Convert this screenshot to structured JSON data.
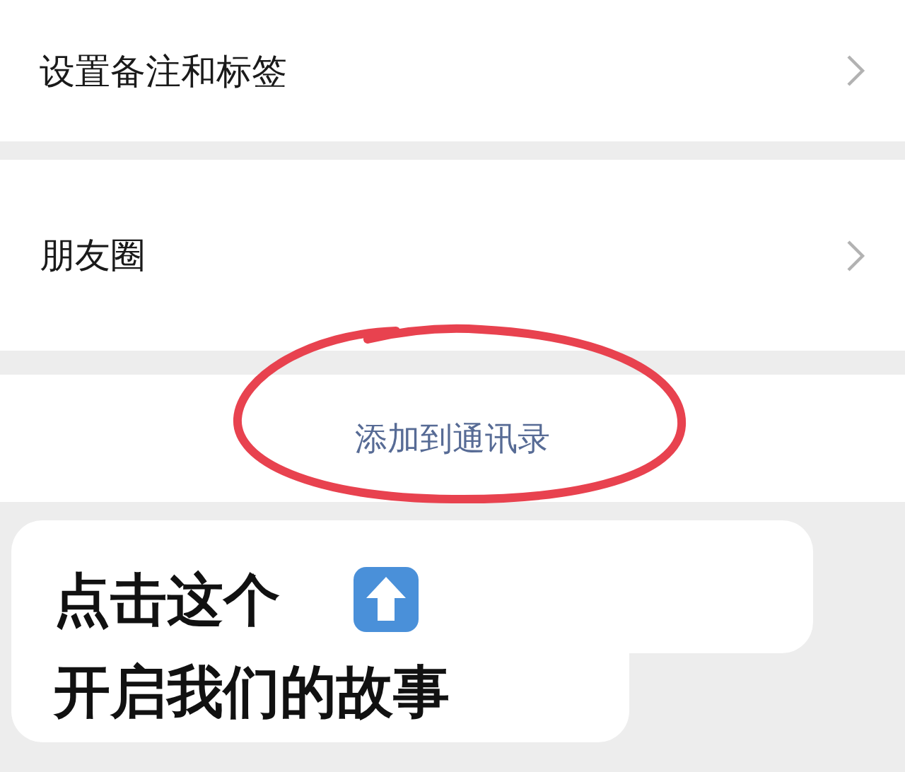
{
  "menu_items": [
    {
      "label": "设置备注和标签"
    },
    {
      "label": "朋友圈"
    }
  ],
  "action": {
    "label": "添加到通讯录"
  },
  "caption": {
    "lines": [
      "点击这个",
      "开启我们的故事"
    ]
  }
}
